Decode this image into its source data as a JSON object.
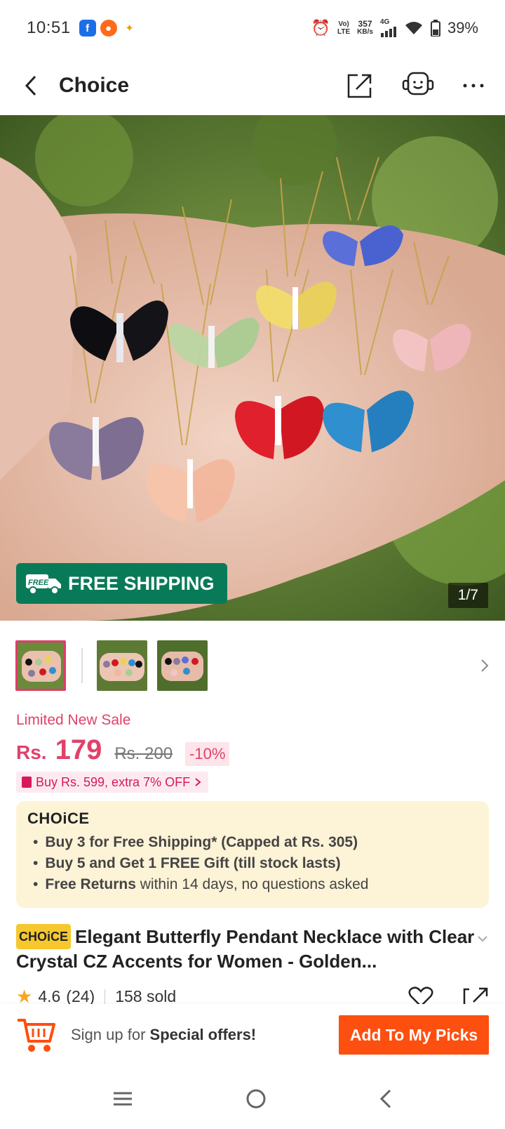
{
  "status": {
    "time": "10:51",
    "volte_top": "Vo)",
    "volte_bottom": "LTE",
    "speed_value": "357",
    "speed_unit": "KB/s",
    "network": "4G",
    "battery": "39%"
  },
  "header": {
    "title": "Choice"
  },
  "gallery": {
    "free_shipping_badge": "FREE SHIPPING",
    "free_badge_small": "FREE",
    "counter": "1/7"
  },
  "price": {
    "sale_label": "Limited New Sale",
    "currency": "Rs.",
    "current": "179",
    "original": "Rs. 200",
    "discount": "-10%"
  },
  "promo": {
    "text": "Buy Rs. 599, extra 7% OFF"
  },
  "choice_card": {
    "logo": "CHOiCE",
    "line1": "Buy 3 for  Free Shipping* (Capped at Rs. 305)",
    "line2": "Buy 5 and Get 1 FREE Gift (till stock lasts)",
    "line3_bold": "Free Returns",
    "line3_rest": "within 14 days, no questions asked"
  },
  "product": {
    "badge": "CHOiCE",
    "title": "Elegant Butterfly Pendant Necklace with Clear Crystal CZ Accents for Women - Golden..."
  },
  "rating": {
    "score": "4.6",
    "count": "(24)",
    "sold": "158 sold"
  },
  "bottom": {
    "signup_prefix": "Sign up for",
    "signup_bold": "Special offers!",
    "add_button": "Add To My Picks"
  },
  "colors": {
    "accent": "#e0426a",
    "cta": "#fd4f0f",
    "free_shipping_green": "#097a58",
    "choice_bg": "#fdf3d7"
  }
}
